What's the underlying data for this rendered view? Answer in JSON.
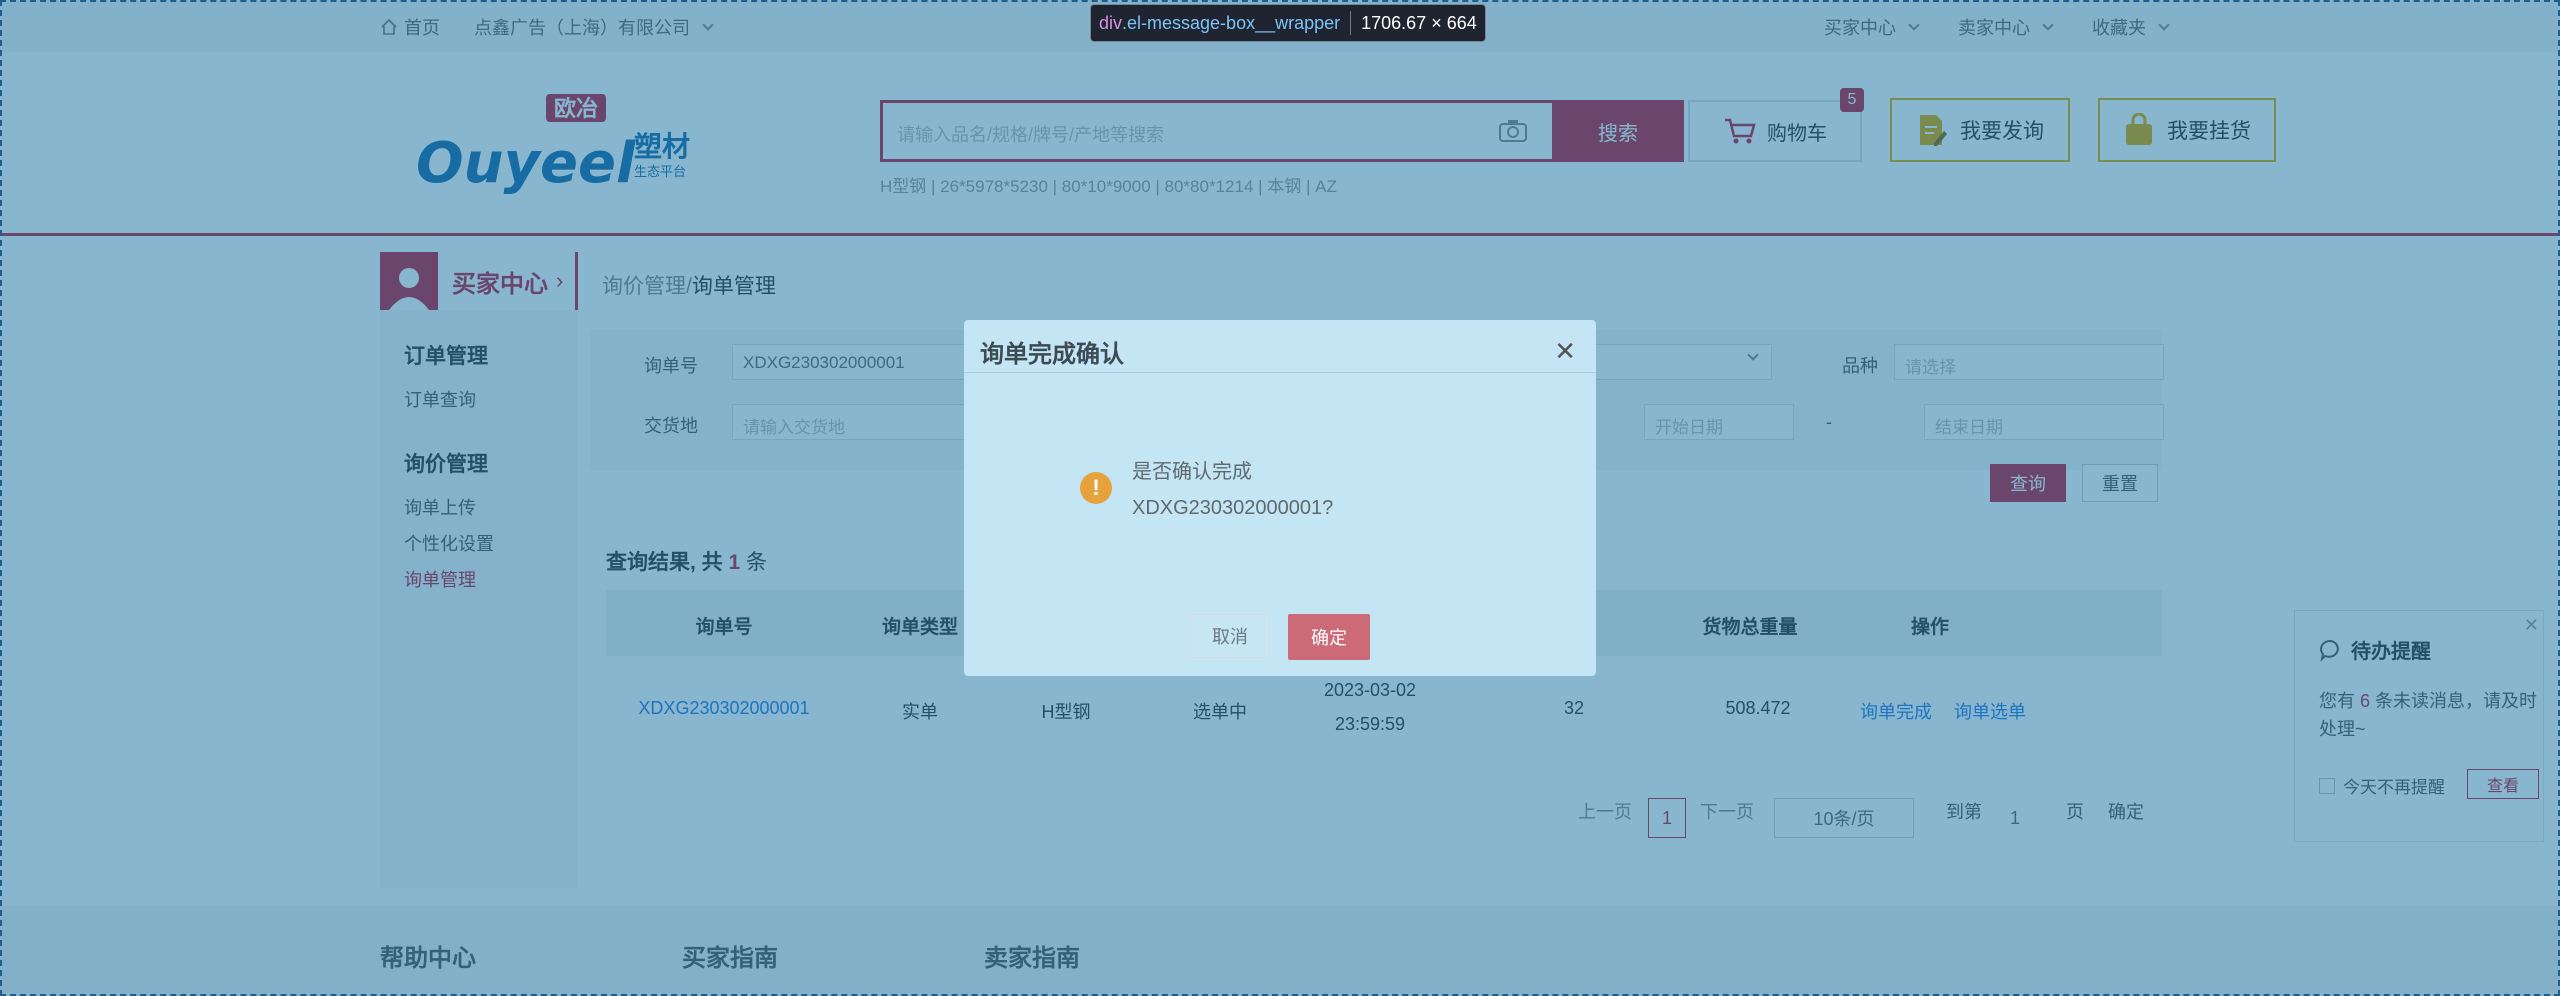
{
  "topbar": {
    "home": "首页",
    "company": "点鑫广告（上海）有限公司",
    "buyer_center": "买家中心",
    "seller_center": "卖家中心",
    "favorites": "收藏夹"
  },
  "header": {
    "logo_main": "Ouyeel",
    "logo_badge": "欧冶",
    "logo_sub1": "塑材",
    "logo_sub2": "生态平台",
    "search_placeholder": "请输入品名/规格/牌号/产地等搜索",
    "search_button": "搜索",
    "cart_label": "购物车",
    "cart_count": "5",
    "hot_terms": "H型钢 | 26*5978*5230 | 80*10*9000 | 80*80*1214 | 本钢 | AZ",
    "inquiry_button": "我要发询",
    "listing_button": "我要挂货"
  },
  "sidebar": {
    "title": "买家中心",
    "groups": [
      {
        "title": "订单管理",
        "items": [
          "订单查询"
        ]
      },
      {
        "title": "询价管理",
        "items": [
          "询单上传",
          "个性化设置",
          "询单管理"
        ]
      }
    ]
  },
  "main": {
    "breadcrumb_parent": "询价管理",
    "breadcrumb_sep": "/",
    "breadcrumb_current": "询单管理",
    "filters": {
      "order_no_label": "询单号",
      "order_no_value": "XDXG230302000001",
      "variety_label": "品种",
      "variety_placeholder": "请选择",
      "delivery_label": "交货地",
      "delivery_placeholder": "请输入交货地",
      "start_date_placeholder": "开始日期",
      "range_sep": "-",
      "end_date_placeholder": "结束日期",
      "query_button": "查询",
      "reset_button": "重置"
    },
    "result_prefix": "查询结果, 共",
    "result_count": "1",
    "result_suffix": "条",
    "table": {
      "headers": [
        "询单号",
        "询单类型",
        "",
        "",
        "",
        "",
        "货物总重量",
        "操作"
      ],
      "rows": [
        {
          "order_no": "XDXG230302000001",
          "type": "实单",
          "variety": "H型钢",
          "status": "选单中",
          "date": "2023-03-02",
          "time": "23:59:59",
          "count": "32",
          "weight": "508.472",
          "action1": "询单完成",
          "action2": "询单选单"
        }
      ]
    },
    "pagination": {
      "prev": "上一页",
      "page": "1",
      "next": "下一页",
      "page_size": "10条/页",
      "goto_label": "到第",
      "goto_value": "1",
      "page_unit": "页",
      "confirm": "确定"
    }
  },
  "footer": {
    "links": [
      "帮助中心",
      "买家指南",
      "卖家指南"
    ]
  },
  "notice": {
    "title": "待办提醒",
    "msg_prefix": "您有",
    "count": "6",
    "msg_suffix": "条未读消息，请及时处理~",
    "checkbox_label": "今天不再提醒",
    "view_button": "查看"
  },
  "dialog": {
    "title": "询单完成确认",
    "line1": "是否确认完成",
    "line2": "XDXG230302000001?",
    "cancel": "取消",
    "confirm": "确定"
  },
  "devtools_tip": {
    "tag": "div",
    "selector": ".el-message-box__wrapper",
    "size": "1706.67 × 664"
  },
  "colors": {
    "brand_red": "#c21f3a",
    "overlay": "#126e9e",
    "link_blue": "#2a7ae2"
  }
}
